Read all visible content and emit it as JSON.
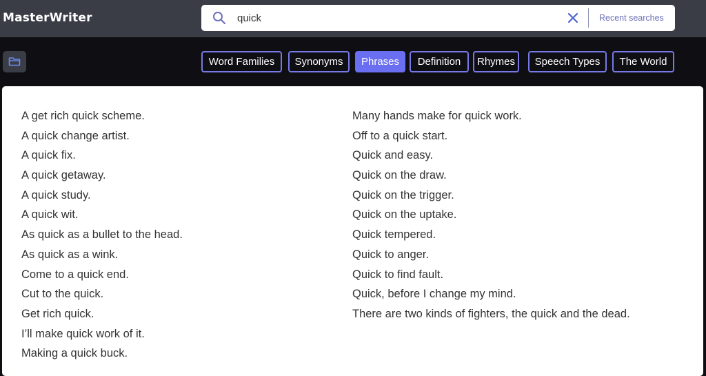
{
  "app": {
    "title": "MasterWriter"
  },
  "search": {
    "value": "quick",
    "recent_label": "Recent searches"
  },
  "tabs": [
    {
      "label": "Word Families",
      "active": false
    },
    {
      "label": "Synonyms",
      "active": false
    },
    {
      "label": "Phrases",
      "active": true
    },
    {
      "label": "Definition",
      "active": false
    },
    {
      "label": "Rhymes",
      "active": false
    },
    {
      "label": "Speech Types",
      "active": false
    },
    {
      "label": "The World",
      "active": false
    }
  ],
  "icons": {
    "search": "search-icon",
    "clear": "close-icon",
    "folder": "folder-icon"
  },
  "colors": {
    "accent": "#6a6ef0",
    "tab_border": "#7779e6",
    "topbar": "#3a3c46",
    "background": "#0f0f13"
  },
  "phrases": {
    "left": [
      "A get rich quick scheme.",
      "A quick change artist.",
      "A quick fix.",
      "A quick getaway.",
      "A quick study.",
      "A quick wit.",
      "As quick as a bullet to the head.",
      "As quick as a wink.",
      "Come to a quick end.",
      "Cut to the quick.",
      "Get rich quick.",
      "I’ll make quick work of it.",
      "Making a quick buck."
    ],
    "right": [
      "Many hands make for quick work.",
      "Off to a quick start.",
      "Quick and easy.",
      "Quick on the draw.",
      "Quick on the trigger.",
      "Quick on the uptake.",
      "Quick tempered.",
      "Quick to anger.",
      "Quick to find fault.",
      "Quick, before I change my mind.",
      "There are two kinds of fighters, the quick and the dead."
    ]
  }
}
